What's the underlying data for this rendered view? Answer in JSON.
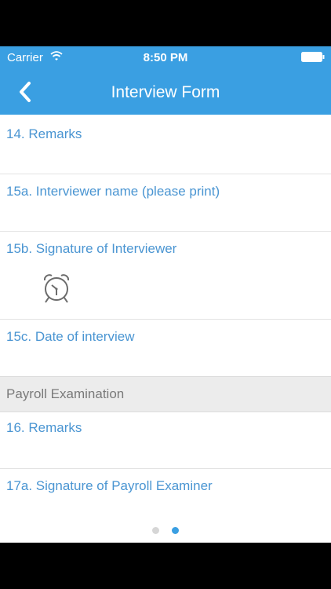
{
  "status_bar": {
    "carrier": "Carrier",
    "time": "8:50 PM"
  },
  "nav": {
    "title": "Interview Form"
  },
  "form": {
    "rows": [
      {
        "label": "14. Remarks"
      },
      {
        "label": "15a. Interviewer name (please print)"
      },
      {
        "label": "15b. Signature of Interviewer"
      },
      {
        "label": "15c. Date of interview"
      }
    ],
    "section_title": "Payroll Examination",
    "section_rows": [
      {
        "label": "16. Remarks"
      },
      {
        "label": "17a. Signature of Payroll Examiner"
      }
    ]
  },
  "pager": {
    "page_count": 2,
    "current_page": 2
  },
  "colors": {
    "header_bg": "#3a9fe2",
    "label_text": "#4a95d2",
    "section_bg": "#ececec"
  },
  "icons": {
    "back": "chevron-left-icon",
    "signature": "alarm-clock-icon",
    "wifi": "wifi-icon",
    "battery": "battery-icon"
  }
}
